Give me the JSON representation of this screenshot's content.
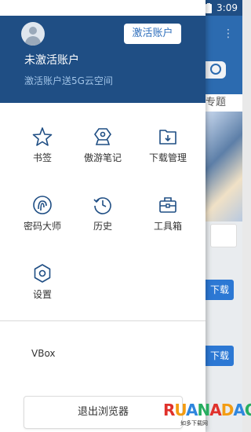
{
  "status_bar": {
    "time": "3:09"
  },
  "background_app": {
    "tab_label": "专题",
    "download_label": "下载"
  },
  "drawer": {
    "activate_button": "激活账户",
    "user_name": "未激活账户",
    "promo_text": "激活账户送5G云空间",
    "menu": [
      {
        "label": "书签",
        "icon": "star-icon"
      },
      {
        "label": "傲游笔记",
        "icon": "note-icon"
      },
      {
        "label": "下载管理",
        "icon": "download-folder-icon"
      },
      {
        "label": "密码大师",
        "icon": "fingerprint-icon"
      },
      {
        "label": "历史",
        "icon": "history-icon"
      },
      {
        "label": "工具箱",
        "icon": "toolbox-icon"
      },
      {
        "label": "设置",
        "icon": "settings-icon"
      }
    ],
    "vbox_label": "VBox",
    "exit_button": "退出浏览器"
  },
  "watermark": {
    "letters": "RUANADAO",
    "sub": "如多下载网"
  },
  "colors": {
    "header": "#1f4e84",
    "accent": "#2c78d4",
    "icon_stroke": "#1f4e84"
  }
}
